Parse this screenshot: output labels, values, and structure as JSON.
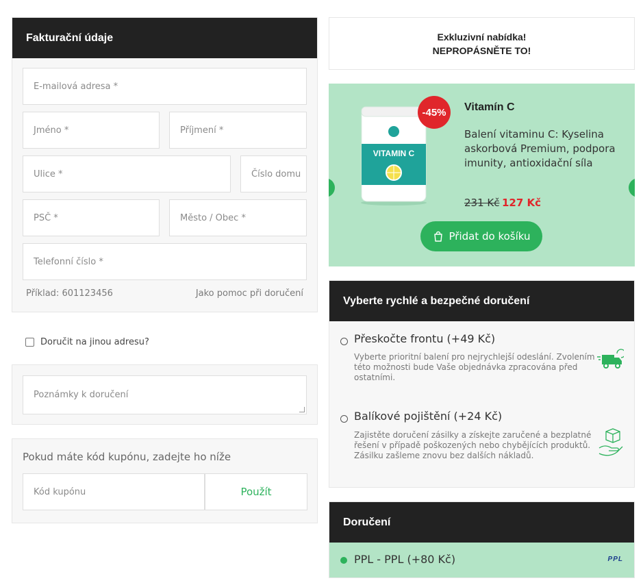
{
  "billing": {
    "title": "Fakturační údaje",
    "email_placeholder": "E-mailová adresa *",
    "first_name_placeholder": "Jméno *",
    "last_name_placeholder": "Příjmení *",
    "street_placeholder": "Ulice *",
    "house_number_placeholder": "Číslo domu",
    "zip_placeholder": "PSČ *",
    "city_placeholder": "Město / Obec *",
    "phone_placeholder": "Telefonní číslo *",
    "phone_example": "Příklad: 601123456",
    "phone_note": "Jako pomoc při doručení"
  },
  "ship_other": {
    "label": "Doručit na jinou adresu?",
    "checked": false
  },
  "notes": {
    "placeholder": "Poznámky k doručení"
  },
  "coupon": {
    "title": "Pokud máte kód kupónu, zadejte ho níže",
    "placeholder": "Kód kupónu",
    "button": "Použít"
  },
  "offer": {
    "line1": "Exkluzivní nabídka!",
    "line2": "NEPROPÁSNĚTE TO!",
    "badge": "-45%",
    "product_name": "Vitamín C",
    "description": "Balení vitaminu C: Kyselina askorbová Premium, podpora imunity, antioxidační síla",
    "price_old": "231 Kč",
    "price_new": "127 Kč",
    "add_button": "Přidat do košíku",
    "jar_label": "VITAMIN C",
    "colors": {
      "background": "#b3e4c6",
      "accent": "#2db25c",
      "sale": "#e0262b"
    }
  },
  "delivery_options": {
    "title": "Vyberte rychlé a bezpečné doručení",
    "items": [
      {
        "title": "Přeskočte frontu (+49 Kč)",
        "description": "Vyberte prioritní balení pro nejrychlejší odeslání. Zvolením této možnosti bude Vaše objednávka zpracována před ostatními.",
        "icon": "fast-truck-icon"
      },
      {
        "title": "Balíkové pojištění (+24 Kč)",
        "description": "Zajistěte doručení zásilky a získejte zaručené a bezplatné řešení v případě poškozených nebo chybějících produktů. Zásilku zašleme znovu bez dalších nákladů.",
        "icon": "insured-package-icon"
      }
    ]
  },
  "shipping": {
    "title": "Doručení",
    "option": "PPL - PPL (+80 Kč)",
    "logo_text": "PPL"
  }
}
